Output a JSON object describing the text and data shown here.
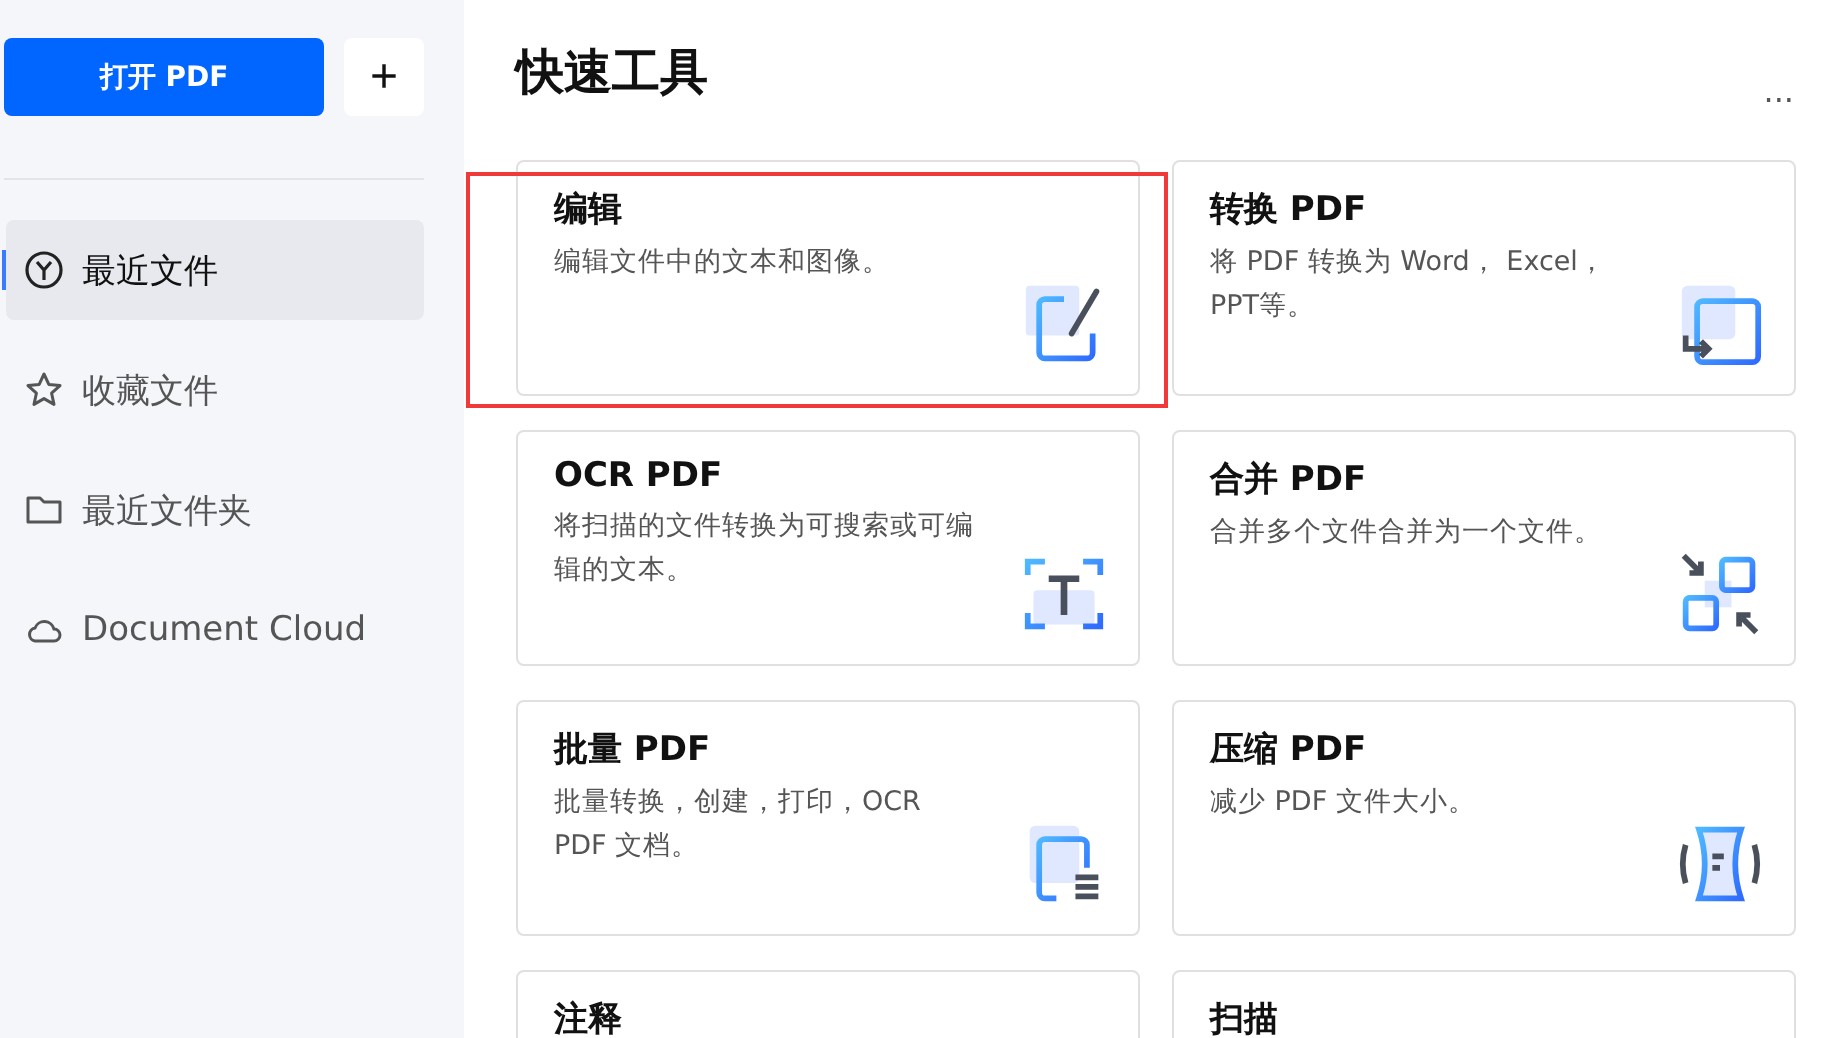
{
  "sidebar": {
    "open_button": "打开 PDF",
    "add_button": "+",
    "items": [
      {
        "label": "最近文件",
        "kind": "clock",
        "selected": true
      },
      {
        "label": "收藏文件",
        "kind": "star",
        "selected": false
      },
      {
        "label": "最近文件夹",
        "kind": "folder",
        "selected": false
      },
      {
        "label": "Document Cloud",
        "kind": "cloud",
        "selected": false
      }
    ]
  },
  "main": {
    "title": "快速工具",
    "more": "...",
    "tools": [
      {
        "title": "编辑",
        "description": "编辑文件中的文本和图像。",
        "kind": "edit",
        "highlighted": true
      },
      {
        "title": "转换 PDF",
        "description": "将 PDF 转换为 Word， Excel，PPT等。",
        "kind": "convert",
        "highlighted": false
      },
      {
        "title": "OCR PDF",
        "description": "将扫描的文件转换为可搜索或可编辑的文本。",
        "kind": "ocr",
        "highlighted": false
      },
      {
        "title": "合并 PDF",
        "description": "合并多个文件合并为一个文件。",
        "kind": "merge",
        "highlighted": false
      },
      {
        "title": "批量 PDF",
        "description": "批量转换，创建，打印，OCR PDF 文档。",
        "kind": "batch",
        "highlighted": false
      },
      {
        "title": "压缩 PDF",
        "description": "减少 PDF 文件大小。",
        "kind": "compress",
        "highlighted": false
      },
      {
        "title": "注释",
        "kind": "annotate",
        "highlighted": false
      },
      {
        "title": "扫描",
        "kind": "scan",
        "highlighted": false
      }
    ]
  }
}
